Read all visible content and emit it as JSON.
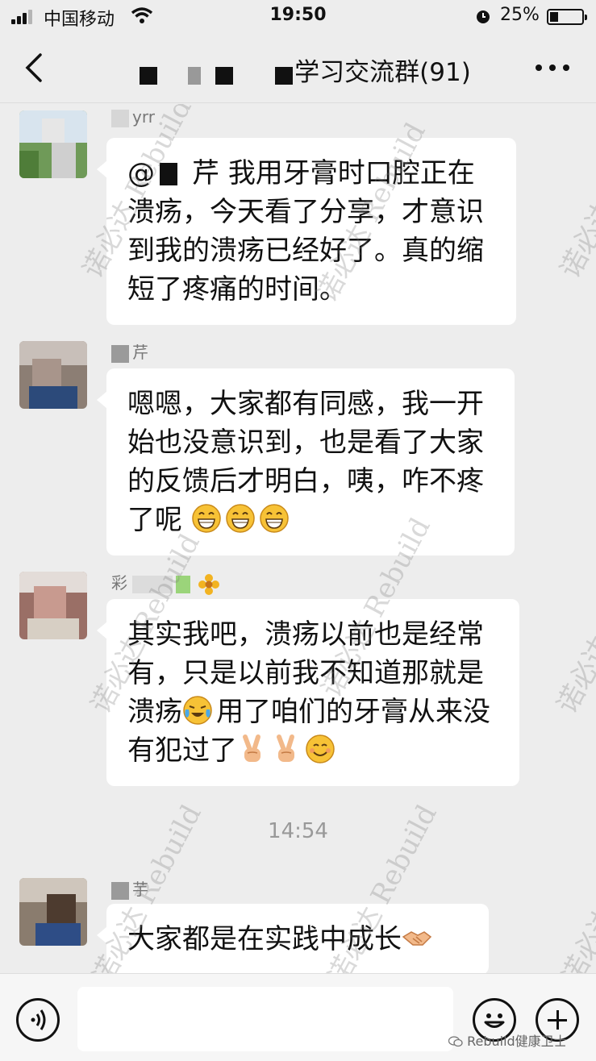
{
  "status_bar": {
    "carrier": "中国移动",
    "time": "19:50",
    "battery": "25%",
    "battery_level": 0.25
  },
  "header": {
    "title": "学习交流群(91)"
  },
  "messages": [
    {
      "sender": "yrr",
      "mention_suffix": "芹",
      "text": "我用牙膏时口腔正在溃疡，今天看了分享，才意识到我的溃疡已经好了。真的缩短了疼痛的时间。"
    },
    {
      "sender": "芹",
      "text": "嗯嗯，大家都有同感，我一开始也没意识到，也是看了大家的反馈后才明白，咦，咋不疼了呢",
      "emojis": [
        "grin-emoji",
        "grin-emoji",
        "grin-emoji"
      ]
    },
    {
      "sender": "彩",
      "text_before_emoji": "其实我吧，溃疡以前也是经常有，只是以前我不知道那就是溃疡",
      "text_after_emoji": "用了咱们的牙膏从来没有犯过了",
      "emojis": [
        "tears-of-joy-emoji",
        "victory-emoji",
        "victory-emoji",
        "smile-emoji"
      ]
    },
    {
      "sender": "芋",
      "text": "大家都是在实践中成长",
      "emojis": [
        "handshake-emoji"
      ]
    }
  ],
  "time_divider": "14:54",
  "watermark": "诺必达 Rebuild",
  "source_tag": "Rebuild健康卫士"
}
